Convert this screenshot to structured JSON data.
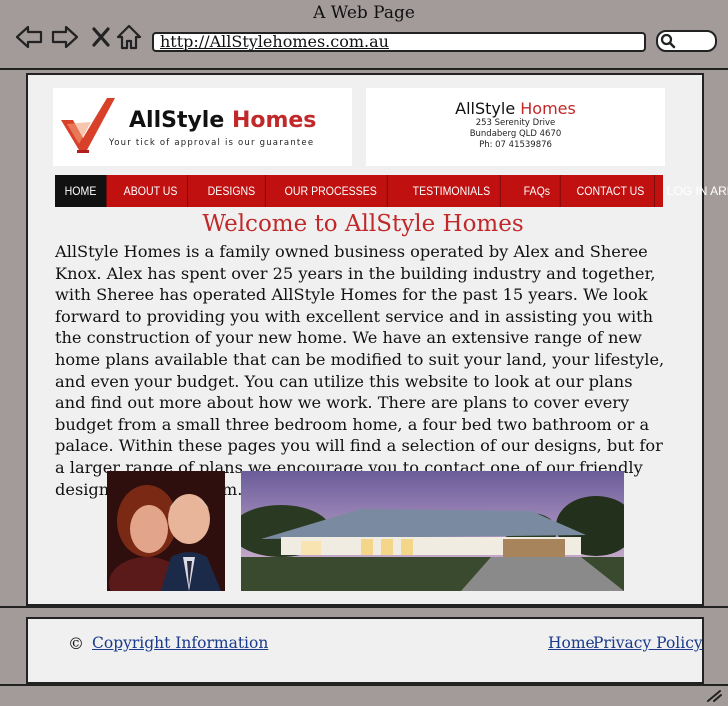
{
  "browser": {
    "window_title": "A Web Page",
    "url": "http://AllStylehomes.com.au"
  },
  "header": {
    "brand_name_part1": "AllStyle ",
    "brand_name_part2": "Homes",
    "tagline": "Your tick of approval is our guarantee",
    "contact_name_part1": "AllStyle ",
    "contact_name_part2": "Homes",
    "contact_address_line1": "253 Serenity Drive",
    "contact_address_line2": "Bundaberg QLD 4670",
    "contact_phone": "Ph: 07 41539876"
  },
  "nav": {
    "items": [
      "HOME",
      "ABOUT US",
      "DESIGNS",
      "OUR PROCESSES",
      "TESTIMONIALS",
      "FAQs",
      "CONTACT US"
    ],
    "login": "LOG IN AREA",
    "active_index": 0
  },
  "main": {
    "heading": "Welcome to AllStyle Homes",
    "intro": "AllStyle Homes is a family owned business operated by Alex and Sheree Knox. Alex has spent over 25 years in the building industry and together, with Sheree has operated AllStyle Homes for the past 15 years. We look forward to providing you with excellent service and in assisting you with the construction of your new home. We have an extensive range of new home plans available that can be modified to suit your land, your lifestyle, and even your budget. You can utilize this website to look at our plans and find out more about how we work. There are plans to cover every budget from a small three bedroom home, a four bed two bathroom or a palace. Within these pages you will find a selection of our designs, but for a larger range of plans we encourage you to contact one of our friendly design and sales team."
  },
  "footer": {
    "copyright_symbol": "©",
    "copyright_link": "Copyright Information",
    "home_link": "Home",
    "privacy_link": "Privacy Policy"
  },
  "colors": {
    "brand_red": "#c0282a",
    "nav_red": "#c01010",
    "nav_active": "#111111",
    "link_blue": "#1a3a8a"
  }
}
